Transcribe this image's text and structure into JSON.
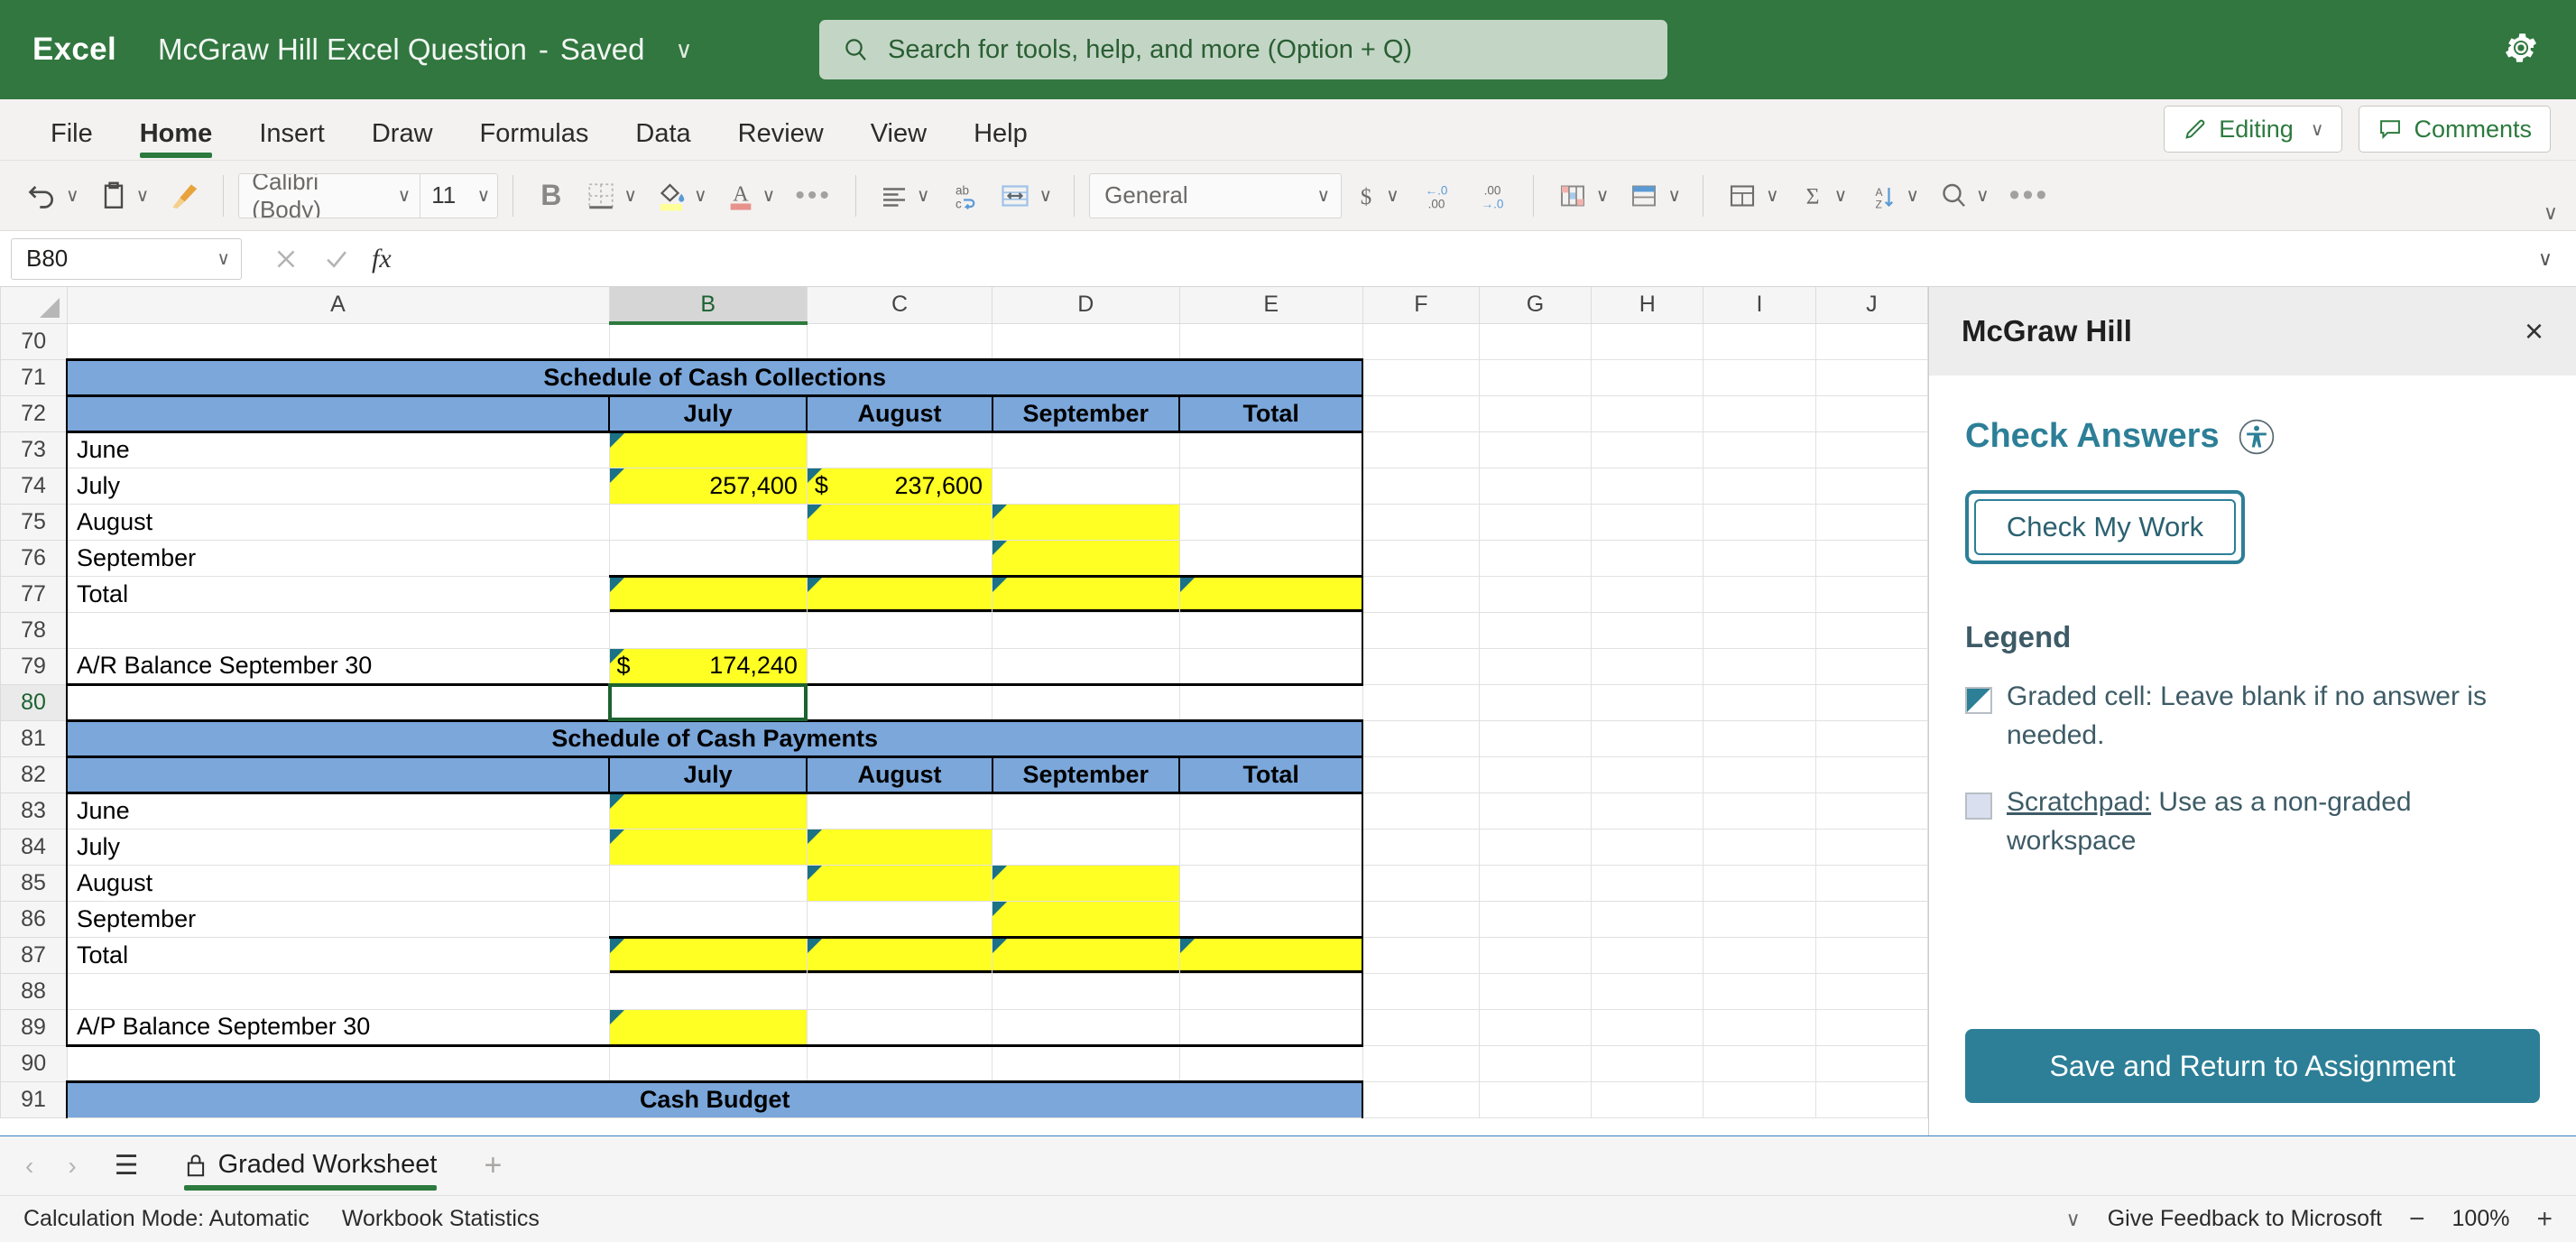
{
  "titlebar": {
    "app_name": "Excel",
    "doc_title": "McGraw Hill Excel Question",
    "separator": "-",
    "saved_status": "Saved",
    "caret": "∨",
    "search_placeholder": "Search for tools, help, and more (Option + Q)",
    "brand_color": "#31773f"
  },
  "tabs": [
    {
      "label": "File",
      "active": false
    },
    {
      "label": "Home",
      "active": true
    },
    {
      "label": "Insert",
      "active": false
    },
    {
      "label": "Draw",
      "active": false
    },
    {
      "label": "Formulas",
      "active": false
    },
    {
      "label": "Data",
      "active": false
    },
    {
      "label": "Review",
      "active": false
    },
    {
      "label": "View",
      "active": false
    },
    {
      "label": "Help",
      "active": false
    }
  ],
  "tab_actions": {
    "editing_label": "Editing",
    "editing_caret": "∨",
    "comments_label": "Comments"
  },
  "ribbon": {
    "font_name": "Calibri (Body)",
    "font_size": "11",
    "bold_label": "B",
    "number_format": "General",
    "more_dots": "•••",
    "overflow_dots": "•••",
    "collapse_caret": "∨"
  },
  "formula_bar": {
    "name_box": "B80",
    "name_caret": "∨",
    "cancel": "×",
    "confirm": "✓",
    "fx": "fx",
    "formula_value": "",
    "expand_caret": "∨"
  },
  "grid": {
    "columns": [
      "A",
      "B",
      "C",
      "D",
      "E",
      "F",
      "G",
      "H",
      "I",
      "J"
    ],
    "selected_column": "B",
    "selected_row": "80",
    "rows": [
      {
        "num": "70",
        "cells": [
          "",
          "",
          "",
          "",
          "",
          "",
          "",
          "",
          "",
          ""
        ]
      },
      {
        "num": "71",
        "cells": [
          "Schedule of Cash Collections",
          "",
          "",
          "",
          "",
          "",
          "",
          "",
          "",
          ""
        ]
      },
      {
        "num": "72",
        "cells": [
          "",
          "July",
          "August",
          "September",
          "Total",
          "",
          "",
          "",
          "",
          ""
        ]
      },
      {
        "num": "73",
        "cells": [
          "June",
          "",
          "",
          "",
          "",
          "",
          "",
          "",
          "",
          ""
        ]
      },
      {
        "num": "74",
        "cells": [
          "July",
          "257,400",
          "237,600",
          "",
          "",
          "",
          "",
          "",
          "",
          ""
        ]
      },
      {
        "num": "75",
        "cells": [
          "August",
          "",
          "",
          "",
          "",
          "",
          "",
          "",
          "",
          ""
        ]
      },
      {
        "num": "76",
        "cells": [
          "September",
          "",
          "",
          "",
          "",
          "",
          "",
          "",
          "",
          ""
        ]
      },
      {
        "num": "77",
        "cells": [
          "Total",
          "",
          "",
          "",
          "",
          "",
          "",
          "",
          "",
          ""
        ]
      },
      {
        "num": "78",
        "cells": [
          "",
          "",
          "",
          "",
          "",
          "",
          "",
          "",
          "",
          ""
        ]
      },
      {
        "num": "79",
        "cells": [
          "A/R Balance September 30",
          "174,240",
          "",
          "",
          "",
          "",
          "",
          "",
          "",
          ""
        ]
      },
      {
        "num": "80",
        "cells": [
          "",
          "",
          "",
          "",
          "",
          "",
          "",
          "",
          "",
          ""
        ]
      },
      {
        "num": "81",
        "cells": [
          "Schedule of Cash Payments",
          "",
          "",
          "",
          "",
          "",
          "",
          "",
          "",
          ""
        ]
      },
      {
        "num": "82",
        "cells": [
          "",
          "July",
          "August",
          "September",
          "Total",
          "",
          "",
          "",
          "",
          ""
        ]
      },
      {
        "num": "83",
        "cells": [
          "June",
          "",
          "",
          "",
          "",
          "",
          "",
          "",
          "",
          ""
        ]
      },
      {
        "num": "84",
        "cells": [
          "July",
          "",
          "",
          "",
          "",
          "",
          "",
          "",
          "",
          ""
        ]
      },
      {
        "num": "85",
        "cells": [
          "August",
          "",
          "",
          "",
          "",
          "",
          "",
          "",
          "",
          ""
        ]
      },
      {
        "num": "86",
        "cells": [
          "September",
          "",
          "",
          "",
          "",
          "",
          "",
          "",
          "",
          ""
        ]
      },
      {
        "num": "87",
        "cells": [
          "Total",
          "",
          "",
          "",
          "",
          "",
          "",
          "",
          "",
          ""
        ]
      },
      {
        "num": "88",
        "cells": [
          "",
          "",
          "",
          "",
          "",
          "",
          "",
          "",
          "",
          ""
        ]
      },
      {
        "num": "89",
        "cells": [
          "A/P Balance September 30",
          "",
          "",
          "",
          "",
          "",
          "",
          "",
          "",
          ""
        ]
      },
      {
        "num": "90",
        "cells": [
          "",
          "",
          "",
          "",
          "",
          "",
          "",
          "",
          "",
          ""
        ]
      },
      {
        "num": "91",
        "cells": [
          "Cash Budget",
          "",
          "",
          "",
          "",
          "",
          "",
          "",
          "",
          ""
        ]
      }
    ],
    "header_fill": "#7ba7db",
    "graded_fill": "#ffff24",
    "graded_marker": "#1b7186"
  },
  "panel": {
    "title": "McGraw Hill",
    "close": "×",
    "check_answers_title": "Check Answers",
    "check_button_label": "Check My Work",
    "legend_title": "Legend",
    "legend_graded_text": "Graded cell: Leave blank if no answer is needed.",
    "legend_scratch_link": "Scratchpad:",
    "legend_scratch_text": " Use as a non-graded workspace",
    "save_button_label": "Save and Return to Assignment",
    "accent_color": "#2c7f97"
  },
  "sheetbar": {
    "prev": "‹",
    "next": "›",
    "menu": "☰",
    "sheet_name": "Graded Worksheet",
    "add_sheet": "+"
  },
  "statusbar": {
    "calculation_mode": "Calculation Mode: Automatic",
    "workbook_statistics": "Workbook Statistics",
    "feedback": "Give Feedback to Microsoft",
    "zoom_out": "−",
    "zoom_level": "100%",
    "zoom_in": "+",
    "scroll_caret": "∨"
  }
}
